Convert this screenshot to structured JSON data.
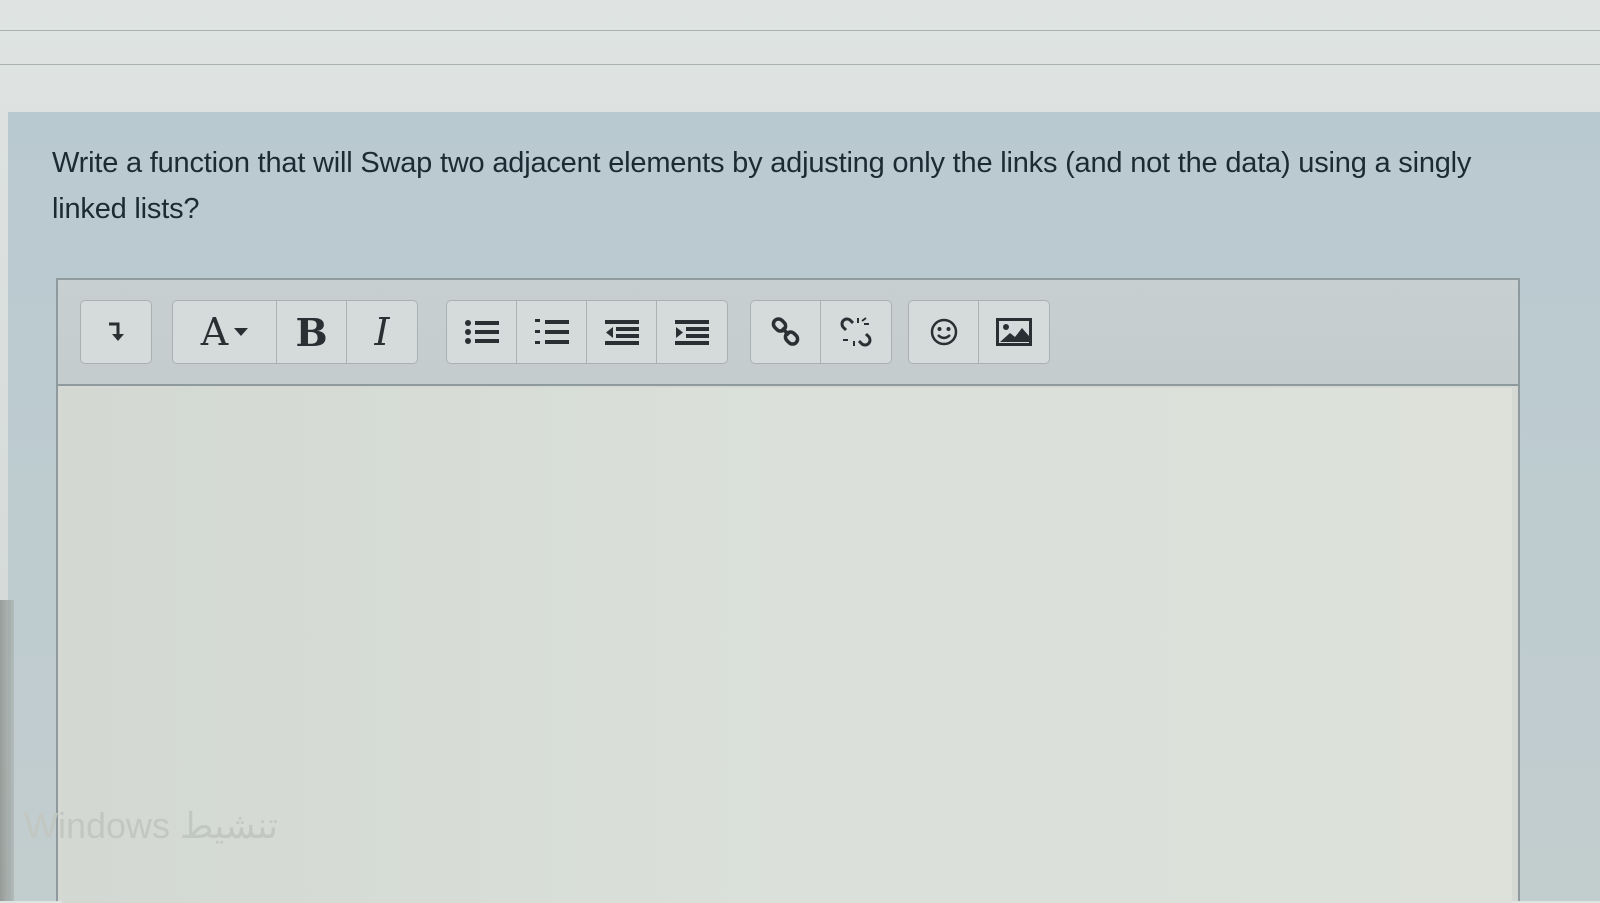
{
  "question": {
    "text": "Write a function that will Swap two adjacent elements by adjusting only the links (and not the data) using a singly linked lists?"
  },
  "toolbar": {
    "groups": [
      {
        "buttons": [
          {
            "icon": "collapse-toolbar-icon"
          }
        ]
      },
      {
        "buttons": [
          {
            "icon": "font-style-dropdown-icon",
            "label": "A"
          },
          {
            "icon": "bold-icon",
            "label": "B"
          },
          {
            "icon": "italic-icon",
            "label": "I"
          }
        ]
      },
      {
        "buttons": [
          {
            "icon": "unordered-list-icon"
          },
          {
            "icon": "ordered-list-icon"
          },
          {
            "icon": "outdent-icon"
          },
          {
            "icon": "indent-icon"
          }
        ]
      },
      {
        "buttons": [
          {
            "icon": "link-icon"
          },
          {
            "icon": "unlink-icon"
          }
        ]
      },
      {
        "buttons": [
          {
            "icon": "emoticon-icon"
          },
          {
            "icon": "image-icon"
          }
        ]
      }
    ]
  },
  "editor": {
    "content": ""
  },
  "watermark": {
    "text": "Windows تنشيط"
  },
  "colors": {
    "panel": "#bccbd0",
    "editor_bg": "#d8ddd7",
    "text": "#1c2a33"
  }
}
